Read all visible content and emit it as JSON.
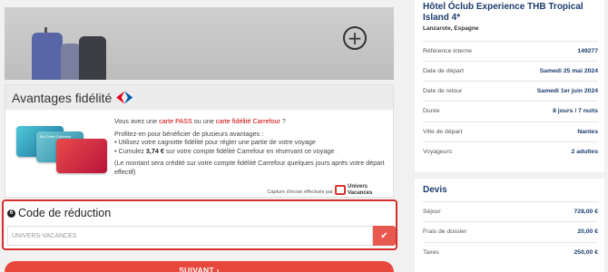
{
  "banner": {
    "add_label": "+"
  },
  "fidelity": {
    "title": "Avantages fidélité",
    "card_text_small": "Ma Carte Carrefour",
    "intro_pre": "Vous avez une ",
    "intro_pass": "carte PASS",
    "intro_mid": " ou une ",
    "intro_card": "carte fidélité Carrefour",
    "intro_post": " ?",
    "benefits_intro": "Profitez-en pour bénéficier de plusieurs avantages :",
    "benefit_1": "• Utilisez votre cagnotte fidélité pour régler une partie de votre voyage",
    "benefit_2_pre": "• Cumulez ",
    "benefit_2_amount": "3,74 €",
    "benefit_2_post": " sur votre compte fidélité Carrefour en réservant ce voyage",
    "note": "(Le montant sera crédité sur votre compte fidélité Carrefour quelques jours après votre départ effectif)",
    "capture_note": "Capture d'écran effectuée par",
    "logo_line1": "Univers",
    "logo_line2": "Vacances"
  },
  "reduction": {
    "step": "6",
    "title": "Code de réduction",
    "input_value": "UNIVERS-VACANCES",
    "submit_icon": "check-icon"
  },
  "next": {
    "label": "SUIVANT  ›"
  },
  "hotel": {
    "name": "Hôtel Óclub Experience THB Tropical Island 4*",
    "location": "Lanzarote, Espagne",
    "rows": [
      {
        "key": "Référence interne",
        "value": "149277"
      },
      {
        "key": "Date de départ",
        "value": "Samedi 25 mai 2024"
      },
      {
        "key": "Date de retour",
        "value": "Samedi 1er juin 2024"
      },
      {
        "key": "Durée",
        "value": "8 jours / 7 nuits"
      },
      {
        "key": "Ville de départ",
        "value": "Nantes"
      },
      {
        "key": "Voyageurs",
        "value": "2 adultes"
      }
    ]
  },
  "devis": {
    "title": "Devis",
    "rows": [
      {
        "key": "Séjour",
        "value": "728,00 €"
      },
      {
        "key": "Frais de dossier",
        "value": "20,00 €"
      },
      {
        "key": "Taxes",
        "value": "250,00 €"
      }
    ]
  },
  "colors": {
    "accent_red": "#e8483c",
    "navy": "#1d3d6e",
    "highlight_border": "#d32f2f"
  }
}
